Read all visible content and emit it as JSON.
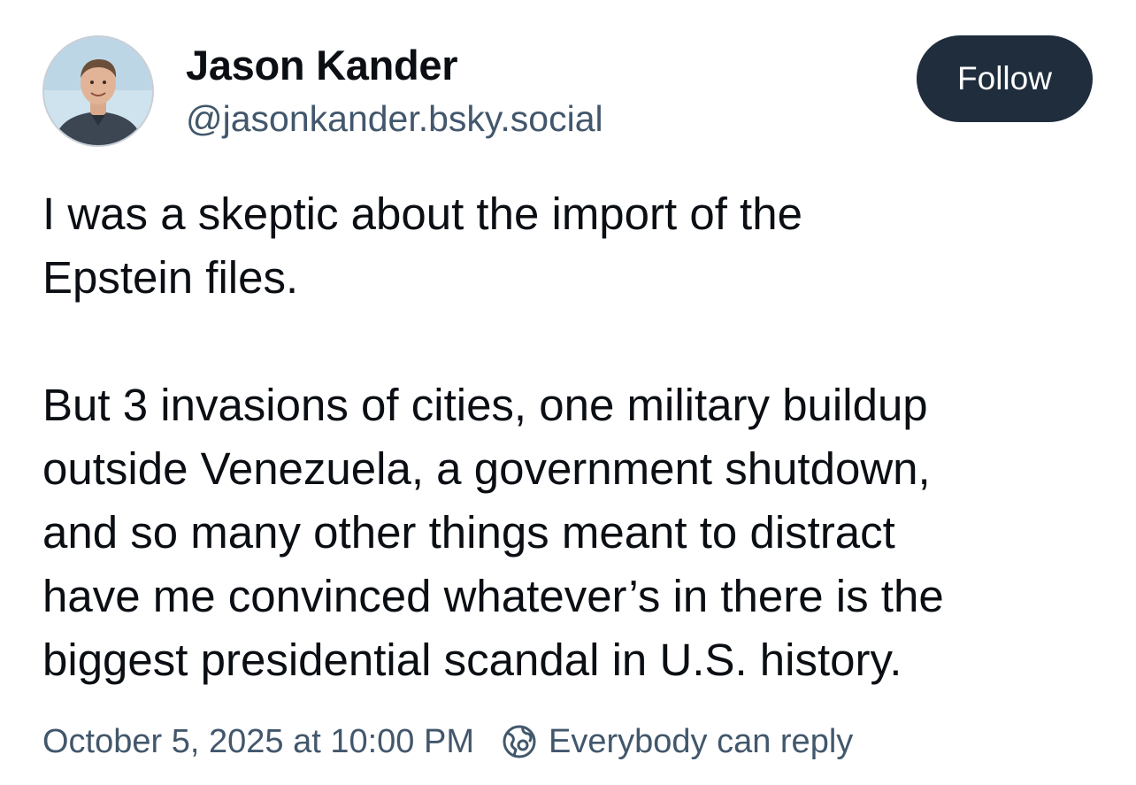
{
  "author": {
    "display_name": "Jason Kander",
    "handle": "@jasonkander.bsky.social",
    "avatar_icon": "profile-photo"
  },
  "follow_button": {
    "label": "Follow",
    "color": "#1f2d3d"
  },
  "post": {
    "paragraph1_lines": [
      "I was a skeptic about the import of the",
      "Epstein files."
    ],
    "paragraph2_lines": [
      "But 3 invasions of cities, one military buildup",
      "outside Venezuela, a government shutdown,",
      "and so many other things meant to distract",
      "have me convinced whatever’s in there is the",
      "biggest presidential scandal in U.S. history."
    ]
  },
  "meta": {
    "timestamp": "October 5, 2025 at 10:00 PM",
    "reply_setting": "Everybody can reply",
    "reply_icon": "globe-icon",
    "secondary_text_color": "#42576c"
  }
}
